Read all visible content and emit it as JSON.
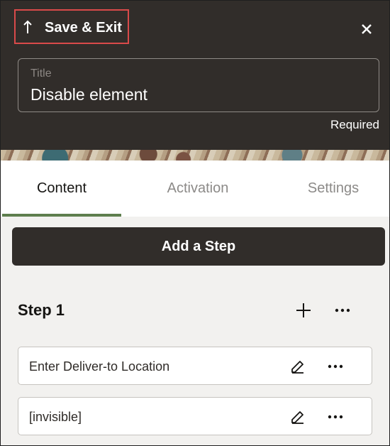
{
  "header": {
    "save_exit_label": "Save & Exit",
    "title_caption": "Title",
    "title_value": "Disable element",
    "required_label": "Required"
  },
  "tabs": [
    {
      "label": "Content",
      "active": true
    },
    {
      "label": "Activation",
      "active": false
    },
    {
      "label": "Settings",
      "active": false
    }
  ],
  "content": {
    "add_step_label": "Add a Step",
    "step_title": "Step 1",
    "items": [
      {
        "label": "Enter Deliver-to Location"
      },
      {
        "label": "[invisible]"
      }
    ]
  },
  "colors": {
    "header_bg": "#312d2a",
    "highlight_border": "#d94a4a",
    "active_tab_indicator": "#5e7e4e",
    "panel_bg": "#f2f1ef"
  },
  "icons": {
    "save_exit": "up-arrow-icon",
    "close": "close-icon",
    "add": "plus-icon",
    "more": "more-icon",
    "edit": "edit-icon"
  }
}
